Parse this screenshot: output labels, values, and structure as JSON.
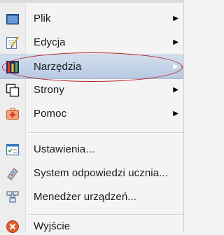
{
  "menu": {
    "items": [
      {
        "label": "Plik",
        "icon": "folder-icon",
        "submenu": true
      },
      {
        "label": "Edycja",
        "icon": "edit-icon",
        "submenu": true
      },
      {
        "label": "Narzędzia",
        "icon": "tools-icon",
        "submenu": true,
        "highlighted": true
      },
      {
        "label": "Strony",
        "icon": "pages-icon",
        "submenu": true
      },
      {
        "label": "Pomoc",
        "icon": "help-icon",
        "submenu": true
      },
      {
        "label": "Ustawienia...",
        "icon": "settings-icon",
        "submenu": false
      },
      {
        "label": "System odpowiedzi ucznia...",
        "icon": "response-system-icon",
        "submenu": false
      },
      {
        "label": "Menedżer urządzeń...",
        "icon": "device-manager-icon",
        "submenu": false
      },
      {
        "label": "Wyjście",
        "icon": "exit-icon",
        "submenu": false
      }
    ],
    "submenu_arrow": "▶"
  },
  "colors": {
    "highlight": "#b7c9e2",
    "annotation_ellipse": "#b8232c",
    "menu_background": "#f4f4f4"
  }
}
